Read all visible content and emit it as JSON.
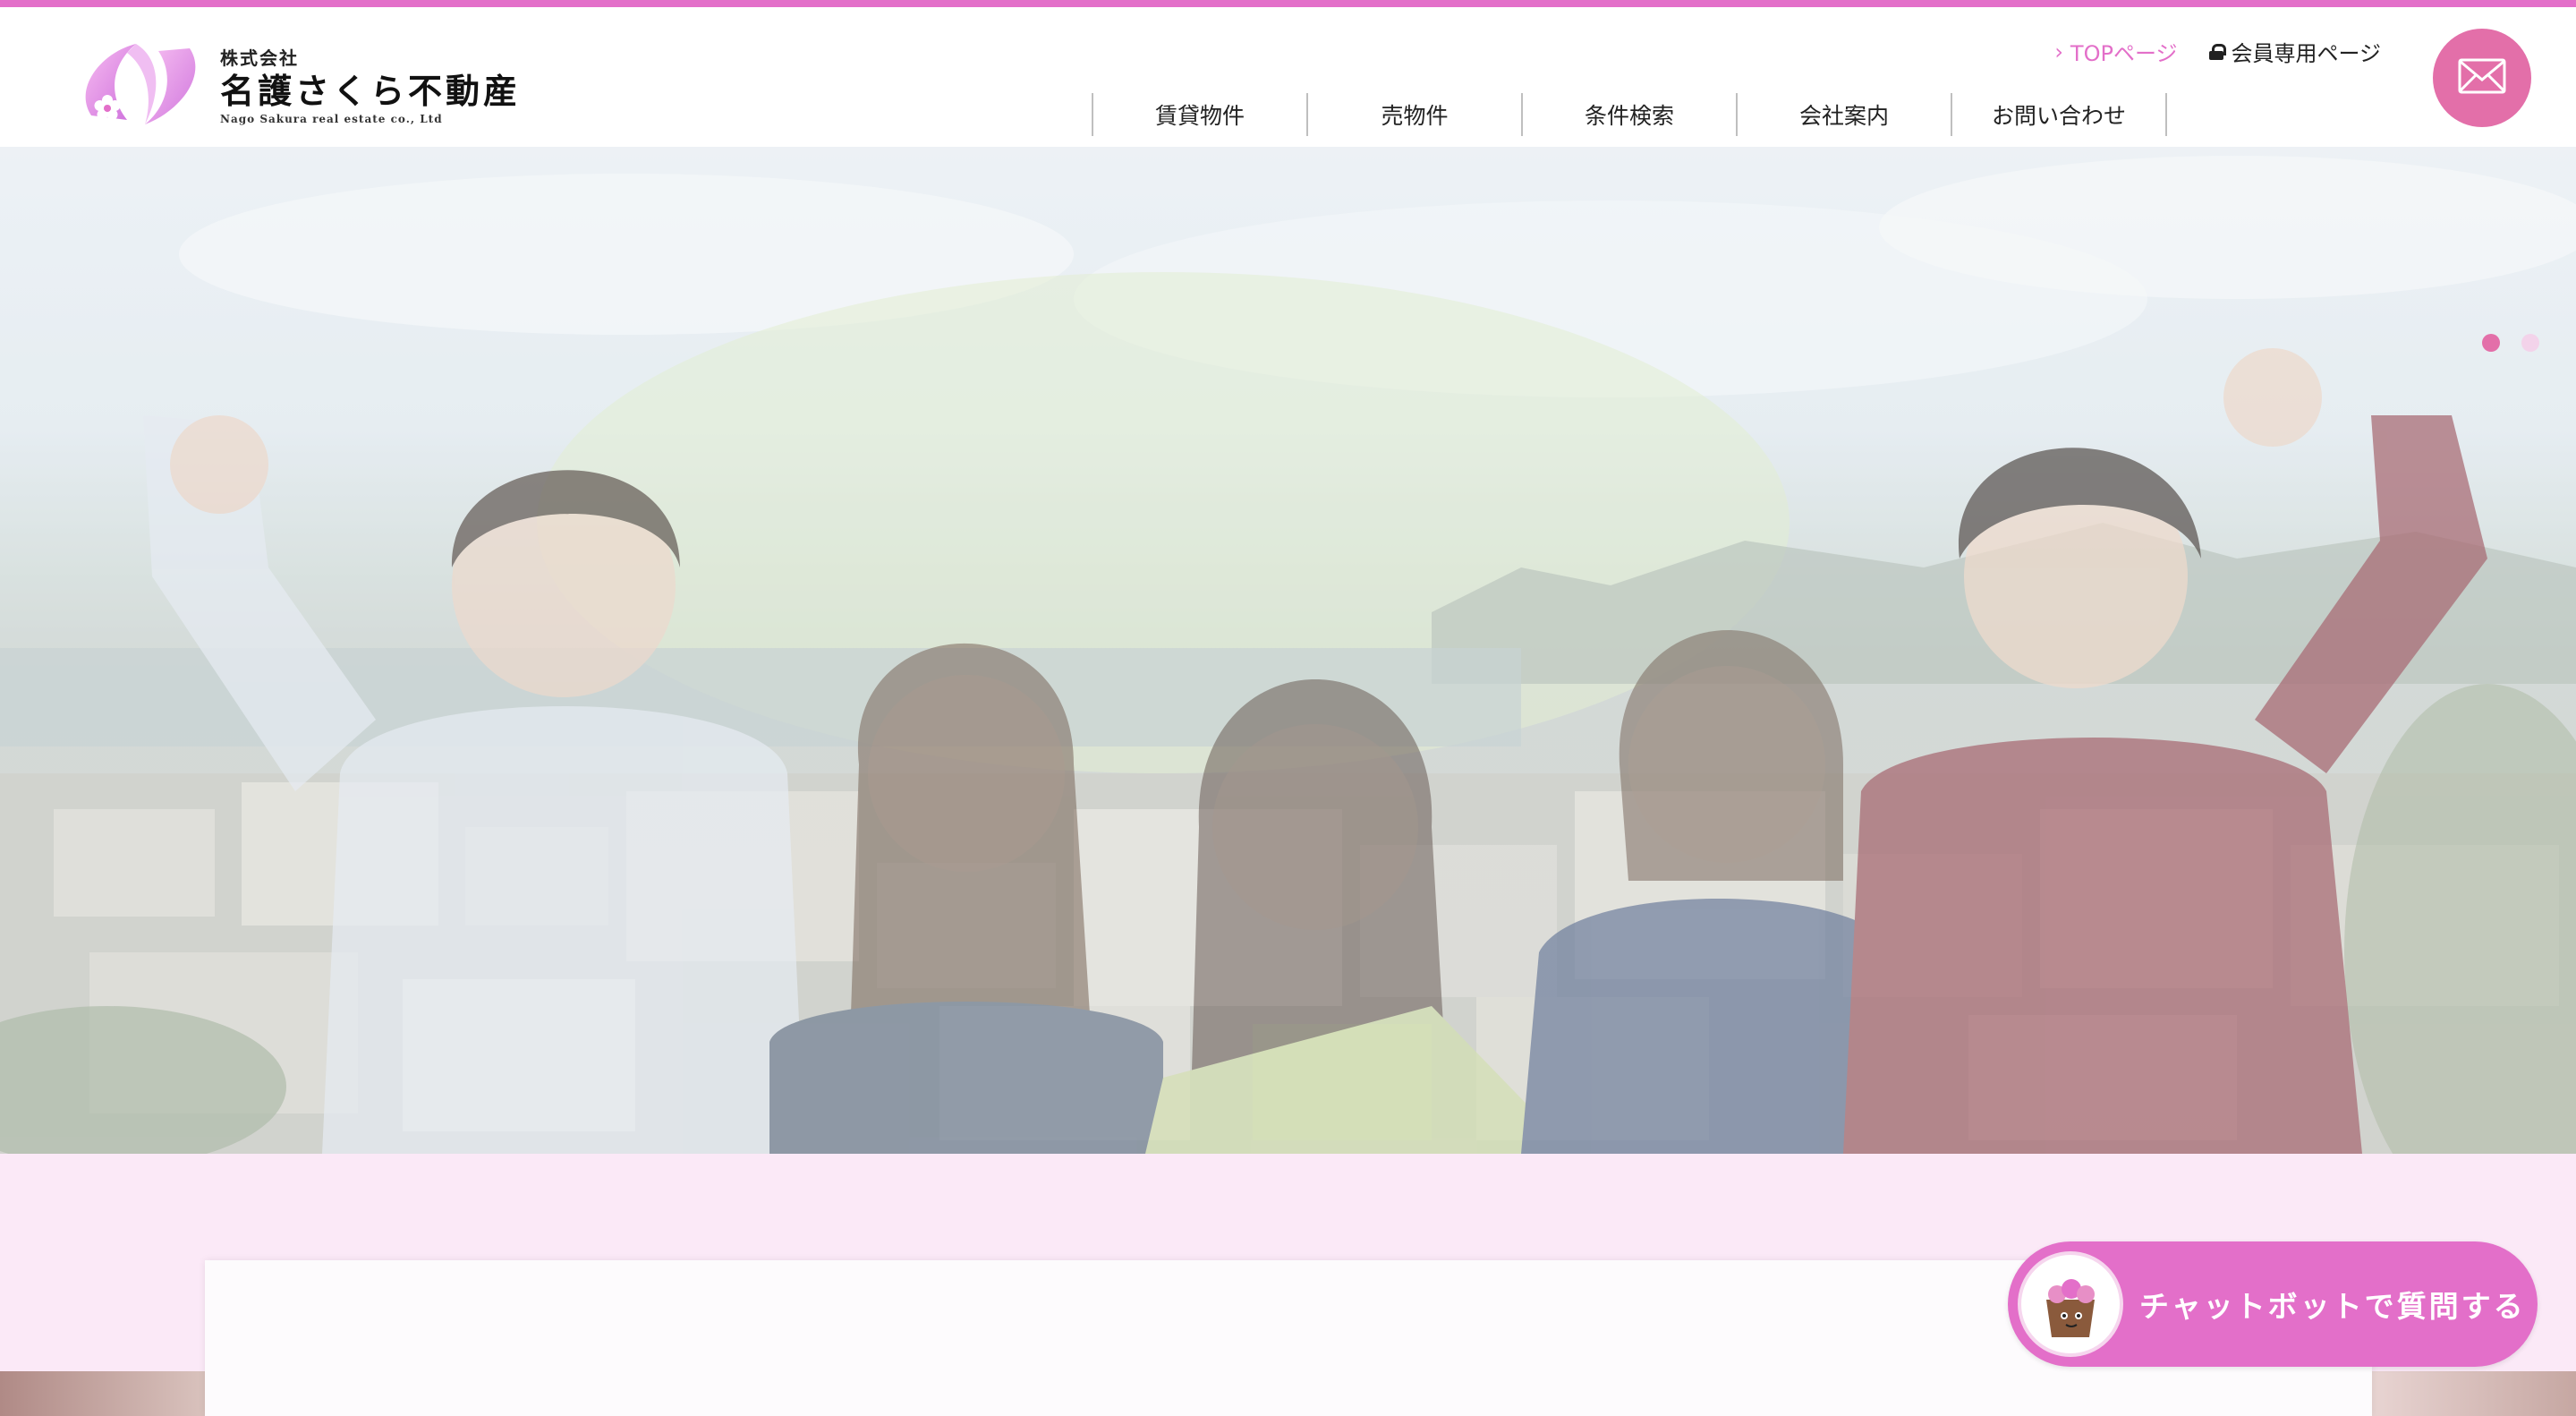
{
  "header": {
    "logo": {
      "small_text": "株式会社",
      "main_text": "名護さくら不動産",
      "roman_text": "Nago Sakura real estate co., Ltd"
    },
    "util_links": {
      "top_page": "TOPページ",
      "member_page": "会員専用ページ"
    },
    "nav": [
      {
        "label": "賃貸物件"
      },
      {
        "label": "売物件"
      },
      {
        "label": "条件検索"
      },
      {
        "label": "会社案内"
      },
      {
        "label": "お問い合わせ"
      }
    ],
    "mail_icon": "envelope-icon"
  },
  "hero": {
    "slide_count": 2,
    "active_slide": 1
  },
  "chatbot": {
    "label": "チャットボットで質問する",
    "avatar_icon": "bag-mascot-icon"
  },
  "colors": {
    "accent_pink": "#e36fc9",
    "mail_pink": "#e36fa9",
    "section_bg": "#fbe9f7"
  }
}
